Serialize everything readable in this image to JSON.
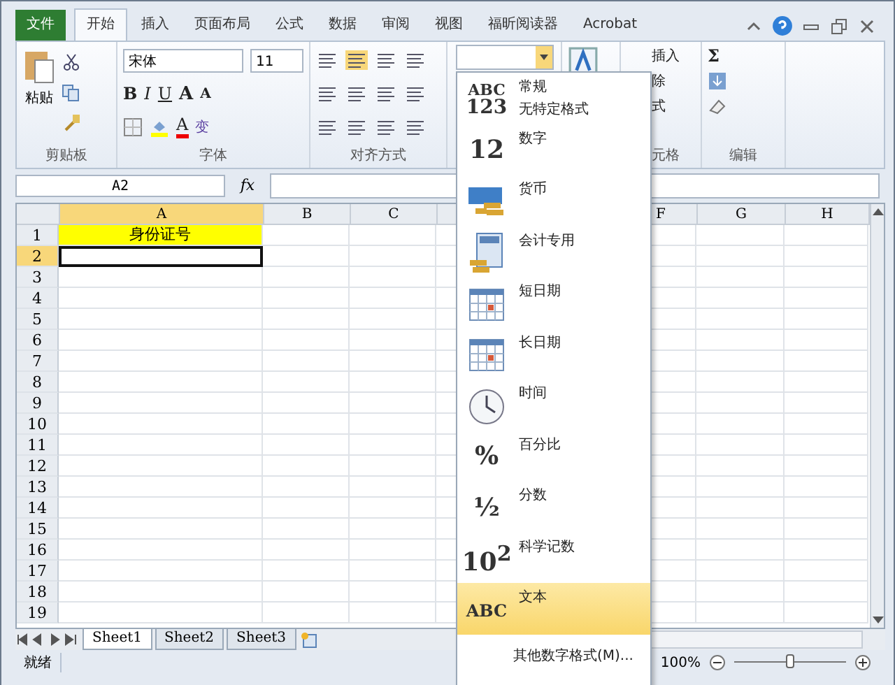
{
  "ribbon_tabs": [
    {
      "label": "文件",
      "kind": "file",
      "selected": false
    },
    {
      "label": "开始",
      "kind": "tab",
      "selected": true
    },
    {
      "label": "插入",
      "kind": "tab",
      "selected": false
    },
    {
      "label": "页面布局",
      "kind": "tab",
      "selected": false
    },
    {
      "label": "公式",
      "kind": "tab",
      "selected": false
    },
    {
      "label": "数据",
      "kind": "tab",
      "selected": false
    },
    {
      "label": "审阅",
      "kind": "tab",
      "selected": false
    },
    {
      "label": "视图",
      "kind": "tab",
      "selected": false
    },
    {
      "label": "福昕阅读器",
      "kind": "tab",
      "selected": false
    },
    {
      "label": "Acrobat",
      "kind": "tab",
      "selected": false
    }
  ],
  "clipboard": {
    "paste": "粘贴",
    "label": "剪贴板"
  },
  "font": {
    "name": "宋体",
    "size": "11",
    "bold": "B",
    "italic": "I",
    "underline": "U",
    "grow": "A",
    "shrink": "A",
    "font_color": "A",
    "phonetic": "变",
    "label": "字体"
  },
  "alignment": {
    "label": "对齐方式"
  },
  "cells": {
    "insert": "插入",
    "delete": "除",
    "format": "式",
    "label": "元格"
  },
  "editing": {
    "sum": "Σ",
    "label": "编辑"
  },
  "formula_bar": {
    "name_box": "A2",
    "fx": "fx"
  },
  "columns": [
    {
      "label": "A",
      "selected": true
    },
    {
      "label": "B",
      "selected": false
    },
    {
      "label": "C",
      "selected": false
    },
    {
      "label": "F",
      "selected": false
    },
    {
      "label": "G",
      "selected": false
    },
    {
      "label": "H",
      "selected": false
    }
  ],
  "rows": [
    {
      "label": "1",
      "selected": false,
      "a": "身份证号"
    },
    {
      "label": "2",
      "selected": true
    },
    {
      "label": "3",
      "selected": false
    },
    {
      "label": "4",
      "selected": false
    },
    {
      "label": "5",
      "selected": false
    },
    {
      "label": "6",
      "selected": false
    },
    {
      "label": "7",
      "selected": false
    },
    {
      "label": "8",
      "selected": false
    },
    {
      "label": "9",
      "selected": false
    },
    {
      "label": "10",
      "selected": false
    },
    {
      "label": "11",
      "selected": false
    },
    {
      "label": "12",
      "selected": false
    },
    {
      "label": "13",
      "selected": false
    },
    {
      "label": "14",
      "selected": false
    },
    {
      "label": "15",
      "selected": false
    },
    {
      "label": "16",
      "selected": false
    },
    {
      "label": "17",
      "selected": false
    },
    {
      "label": "18",
      "selected": false
    },
    {
      "label": "19",
      "selected": false
    }
  ],
  "sheets": [
    {
      "label": "Sheet1",
      "selected": true
    },
    {
      "label": "Sheet2",
      "selected": false
    },
    {
      "label": "Sheet3",
      "selected": false
    }
  ],
  "status_bar": {
    "status": "就绪",
    "zoom": "100%",
    "zoom_level": {
      "level": 0.5
    }
  },
  "format_menu": [
    {
      "kind": "glyph",
      "glyph": "ABC",
      "glyph_2": "123",
      "label": "常规",
      "sublabel": "无特定格式",
      "selected": false
    },
    {
      "kind": "glyph",
      "glyph": "12",
      "label": "数字",
      "selected": false
    },
    {
      "kind": "currency",
      "label": "货币",
      "selected": false
    },
    {
      "kind": "accounting",
      "label": "会计专用",
      "selected": false
    },
    {
      "kind": "date",
      "label": "短日期",
      "selected": false
    },
    {
      "kind": "date",
      "label": "长日期",
      "selected": false
    },
    {
      "kind": "time",
      "label": "时间",
      "selected": false
    },
    {
      "kind": "glyph",
      "glyph": "%",
      "label": "百分比",
      "selected": false
    },
    {
      "kind": "glyph",
      "glyph": "½",
      "label": "分数",
      "selected": false
    },
    {
      "kind": "glyph",
      "glyph": "10$^{2}$",
      "label": "科学记数",
      "selected": false
    },
    {
      "kind": "glyph",
      "glyph": "ABC",
      "label": "文本",
      "selected": true
    },
    {
      "kind": "more",
      "label": "其他数字格式(M)...",
      "selected": false
    }
  ]
}
